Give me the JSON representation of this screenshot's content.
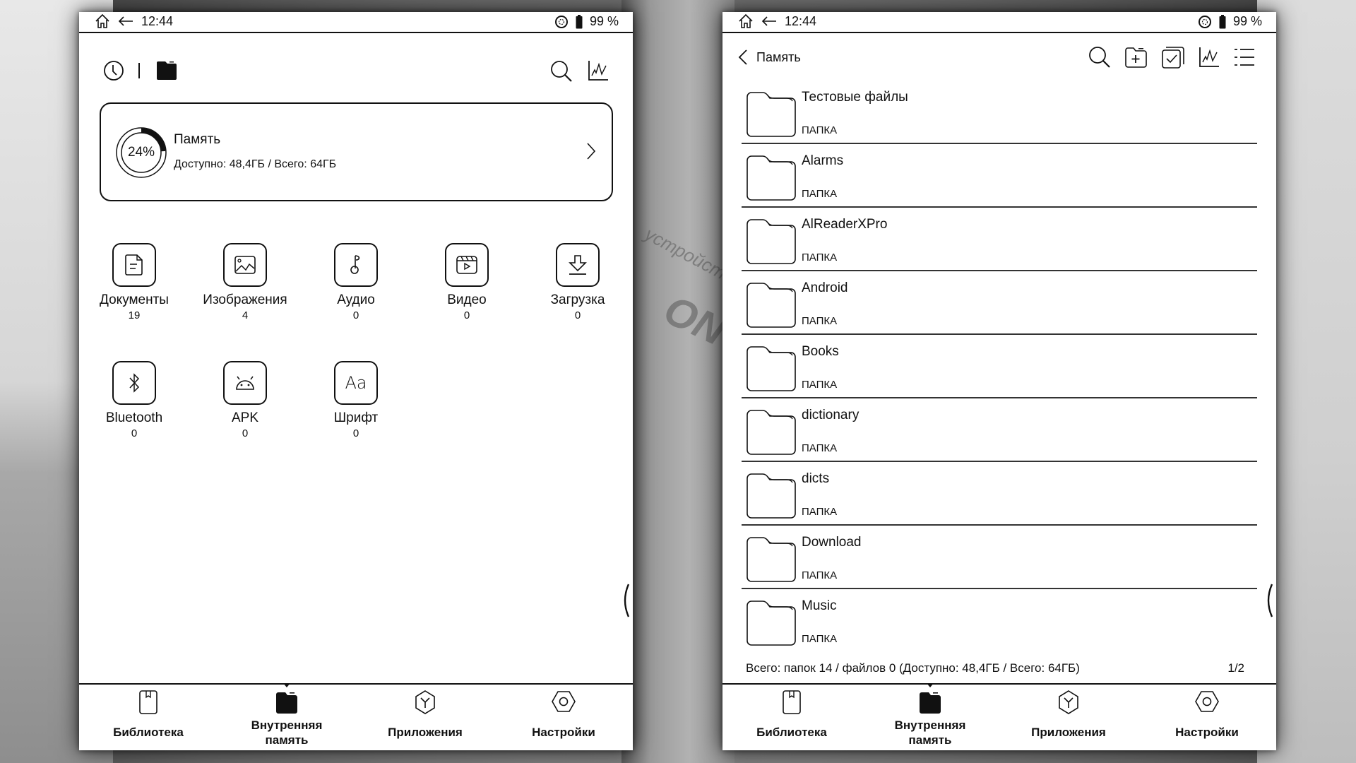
{
  "status_bar": {
    "time": "12:44",
    "battery_percent": "99 %",
    "icons": [
      "home-icon",
      "back-arrow-icon",
      "sync-icon",
      "battery-icon"
    ]
  },
  "left_screen": {
    "toolbar": {
      "left_icons": [
        "recent-clock-icon",
        "folder-filled-icon"
      ],
      "right_icons": [
        "search-icon",
        "statistics-chart-icon"
      ]
    },
    "storage": {
      "title": "Память",
      "used_percent_label": "24%",
      "used_fraction": 0.24,
      "details": "Доступно: 48,4ГБ / Всего: 64ГБ"
    },
    "categories": [
      {
        "label": "Документы",
        "count": "19",
        "icon": "document-icon"
      },
      {
        "label": "Изображения",
        "count": "4",
        "icon": "image-icon"
      },
      {
        "label": "Аудио",
        "count": "0",
        "icon": "music-note-icon"
      },
      {
        "label": "Видео",
        "count": "0",
        "icon": "video-clapper-icon"
      },
      {
        "label": "Загрузка",
        "count": "0",
        "icon": "download-icon"
      },
      {
        "label": "Bluetooth",
        "count": "0",
        "icon": "bluetooth-icon"
      },
      {
        "label": "APK",
        "count": "0",
        "icon": "android-icon"
      },
      {
        "label": "Шрифт",
        "count": "0",
        "icon": "font-icon"
      }
    ]
  },
  "right_screen": {
    "breadcrumb": "Память",
    "toolbar_icons": [
      "search-icon",
      "new-folder-icon",
      "multi-select-icon",
      "statistics-chart-icon",
      "list-view-icon"
    ],
    "files": [
      {
        "name": "Тестовые файлы",
        "type": "ПАПКА"
      },
      {
        "name": "Alarms",
        "type": "ПАПКА"
      },
      {
        "name": "AlReaderXPro",
        "type": "ПАПКА"
      },
      {
        "name": "Android",
        "type": "ПАПКА"
      },
      {
        "name": "Books",
        "type": "ПАПКА"
      },
      {
        "name": "dictionary",
        "type": "ПАПКА"
      },
      {
        "name": "dicts",
        "type": "ПАПКА"
      },
      {
        "name": "Download",
        "type": "ПАПКА"
      },
      {
        "name": "Music",
        "type": "ПАПКА"
      }
    ],
    "summary": "Всего: папок 14 / файлов 0 (Доступно: 48,4ГБ / Всего: 64ГБ)",
    "page": "1/2"
  },
  "bottom_nav": {
    "active_index": 1,
    "items": [
      {
        "label": "Библиотека",
        "icon": "library-book-icon"
      },
      {
        "label": "Внутренняя память",
        "label_line1": "Внутренняя",
        "label_line2": "память",
        "icon": "storage-folder-icon"
      },
      {
        "label": "Приложения",
        "icon": "apps-icon"
      },
      {
        "label": "Настройки",
        "icon": "settings-icon"
      }
    ]
  },
  "background": {
    "watermark_text": "устройство д",
    "watermark_logo": "ON"
  }
}
